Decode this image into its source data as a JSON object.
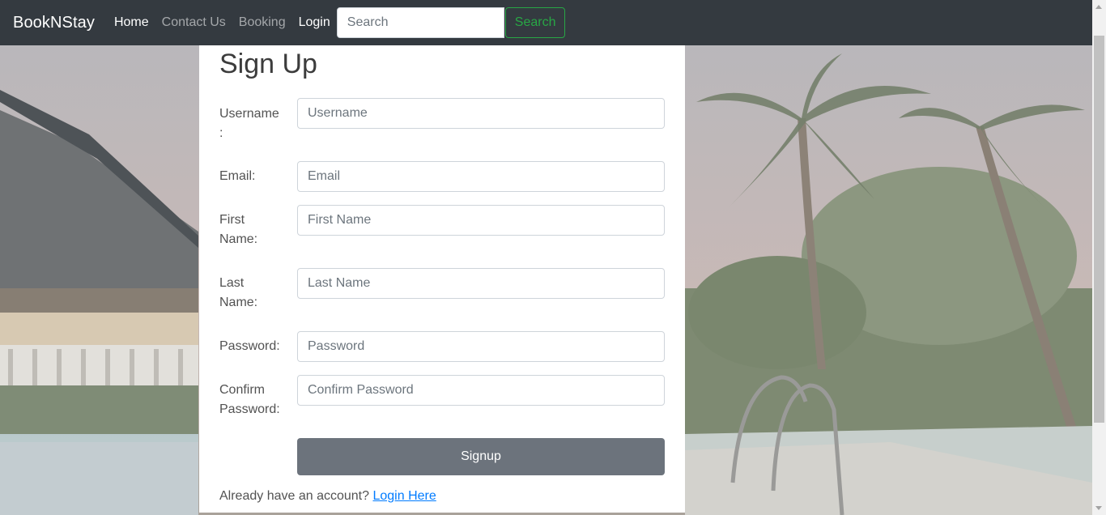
{
  "navbar": {
    "brand": "BookNStay",
    "links": [
      {
        "label": "Home",
        "active": true
      },
      {
        "label": "Contact Us",
        "active": false
      },
      {
        "label": "Booking",
        "active": false
      },
      {
        "label": "Login",
        "active": true
      }
    ],
    "search": {
      "placeholder": "Search",
      "value": "",
      "button_label": "Search"
    }
  },
  "form": {
    "title": "Sign Up",
    "fields": {
      "username": {
        "label": "Username :",
        "placeholder": "Username",
        "value": ""
      },
      "email": {
        "label": "Email:",
        "placeholder": "Email",
        "value": ""
      },
      "first_name": {
        "label": "First Name:",
        "placeholder": "First Name",
        "value": ""
      },
      "last_name": {
        "label": "Last Name:",
        "placeholder": "Last Name",
        "value": ""
      },
      "password": {
        "label": "Password:",
        "placeholder": "Password",
        "value": ""
      },
      "confirm_password": {
        "label": "Confirm Password:",
        "placeholder": "Confirm Password",
        "value": ""
      }
    },
    "submit_label": "Signup",
    "footer_text": "Already have an account?",
    "login_link": "Login Here"
  },
  "colors": {
    "navbar_bg": "#343a40",
    "success": "#28a745",
    "primary_link": "#007bff",
    "signup_button": "#6c737c"
  }
}
